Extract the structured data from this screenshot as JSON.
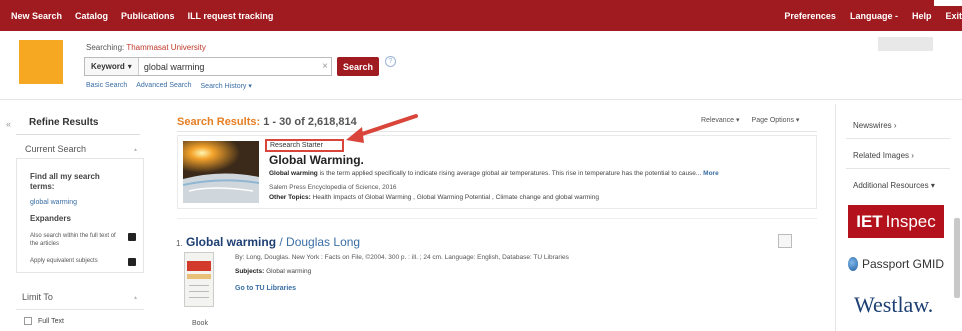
{
  "topnav": {
    "left": [
      "New Search",
      "Catalog",
      "Publications",
      "ILL request tracking"
    ],
    "right": [
      "Preferences",
      "Language -",
      "Help",
      "Exit"
    ]
  },
  "search": {
    "searching_prefix": "Searching:",
    "institution": "Thammasat University",
    "mode": "Keyword",
    "query": "global warming",
    "button": "Search",
    "help": "?",
    "links": [
      "Basic Search",
      "Advanced Search",
      "Search History"
    ]
  },
  "sidebar": {
    "collapse": "«",
    "title": "Refine Results",
    "current_search": "Current Search",
    "find_terms_label": "Find all my search terms:",
    "term": "global warming",
    "expanders_label": "Expanders",
    "expanders": [
      "Also search within the full text of the articles",
      "Apply equivalent subjects"
    ],
    "limit_to": "Limit To",
    "full_text": "Full Text"
  },
  "results": {
    "label": "Search Results:",
    "range": "1 - 30 of 2,618,814",
    "relevance": "Relevance ▾",
    "page_options": "Page Options ▾",
    "research_starter": {
      "badge": "Research Starter",
      "title": "Global Warming.",
      "desc_bold": "Global warming",
      "desc": " is the term applied specifically to indicate rising average global air temperatures. This rise in temperature has the potential to cause...",
      "more": "More",
      "source": "Salem Press Encyclopedia of Science, 2016",
      "topics_label": "Other Topics:",
      "topics": "Health Impacts of Global Warming , Global Warming Potential , Climate change and global warming"
    },
    "items": [
      {
        "index": "1.",
        "title": "Global warming",
        "author": " / Douglas Long",
        "meta": "By: Long, Douglas. New York : Facts on File, ©2004. 300 p. : ill. ; 24 cm. Language: English, Database: TU Libraries",
        "subjects_label": "Subjects:",
        "subjects": "Global warming",
        "link": "Go to TU Libraries",
        "format": "Book"
      }
    ]
  },
  "right_panel": {
    "items": [
      "Newswires ›",
      "Related Images ›",
      "Additional Resources ▾"
    ],
    "resources": {
      "inspec_left": "IET",
      "inspec_right": "Inspec",
      "passport": "Passport GMID",
      "westlaw": "Westlaw."
    }
  },
  "colors": {
    "topbar": "#a01b20",
    "accent_orange": "#e67e22",
    "link_blue": "#3a6ea5",
    "highlight_red": "#d9453b"
  }
}
